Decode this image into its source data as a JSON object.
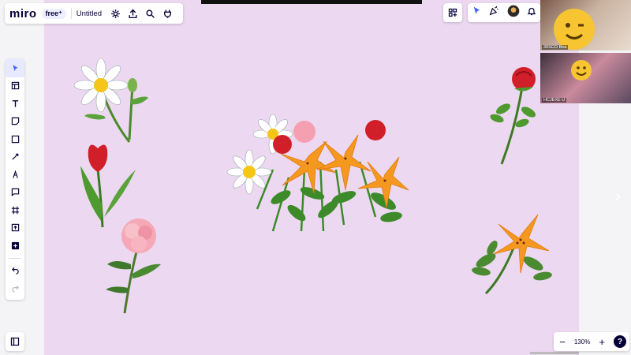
{
  "app": {
    "logo": "miro",
    "plan_badge": "free⁺",
    "board_title": "Untitled"
  },
  "toolbar_icons": [
    "select-icon",
    "templates-icon",
    "text-icon",
    "sticky-note-icon",
    "shape-icon",
    "connection-line-icon",
    "pen-icon",
    "comment-icon",
    "frame-icon",
    "upload-icon",
    "more-apps-icon",
    "undo-icon",
    "redo-icon"
  ],
  "zoom": {
    "minus": "−",
    "level": "130%",
    "plus": "+",
    "help": "?"
  },
  "participants": [
    {
      "label": "30SCO Bea"
    },
    {
      "label": "HCJEXE U"
    }
  ],
  "colors": {
    "canvas": "#ecd8f0",
    "accent": "#4262ff",
    "ink": "#050038"
  }
}
